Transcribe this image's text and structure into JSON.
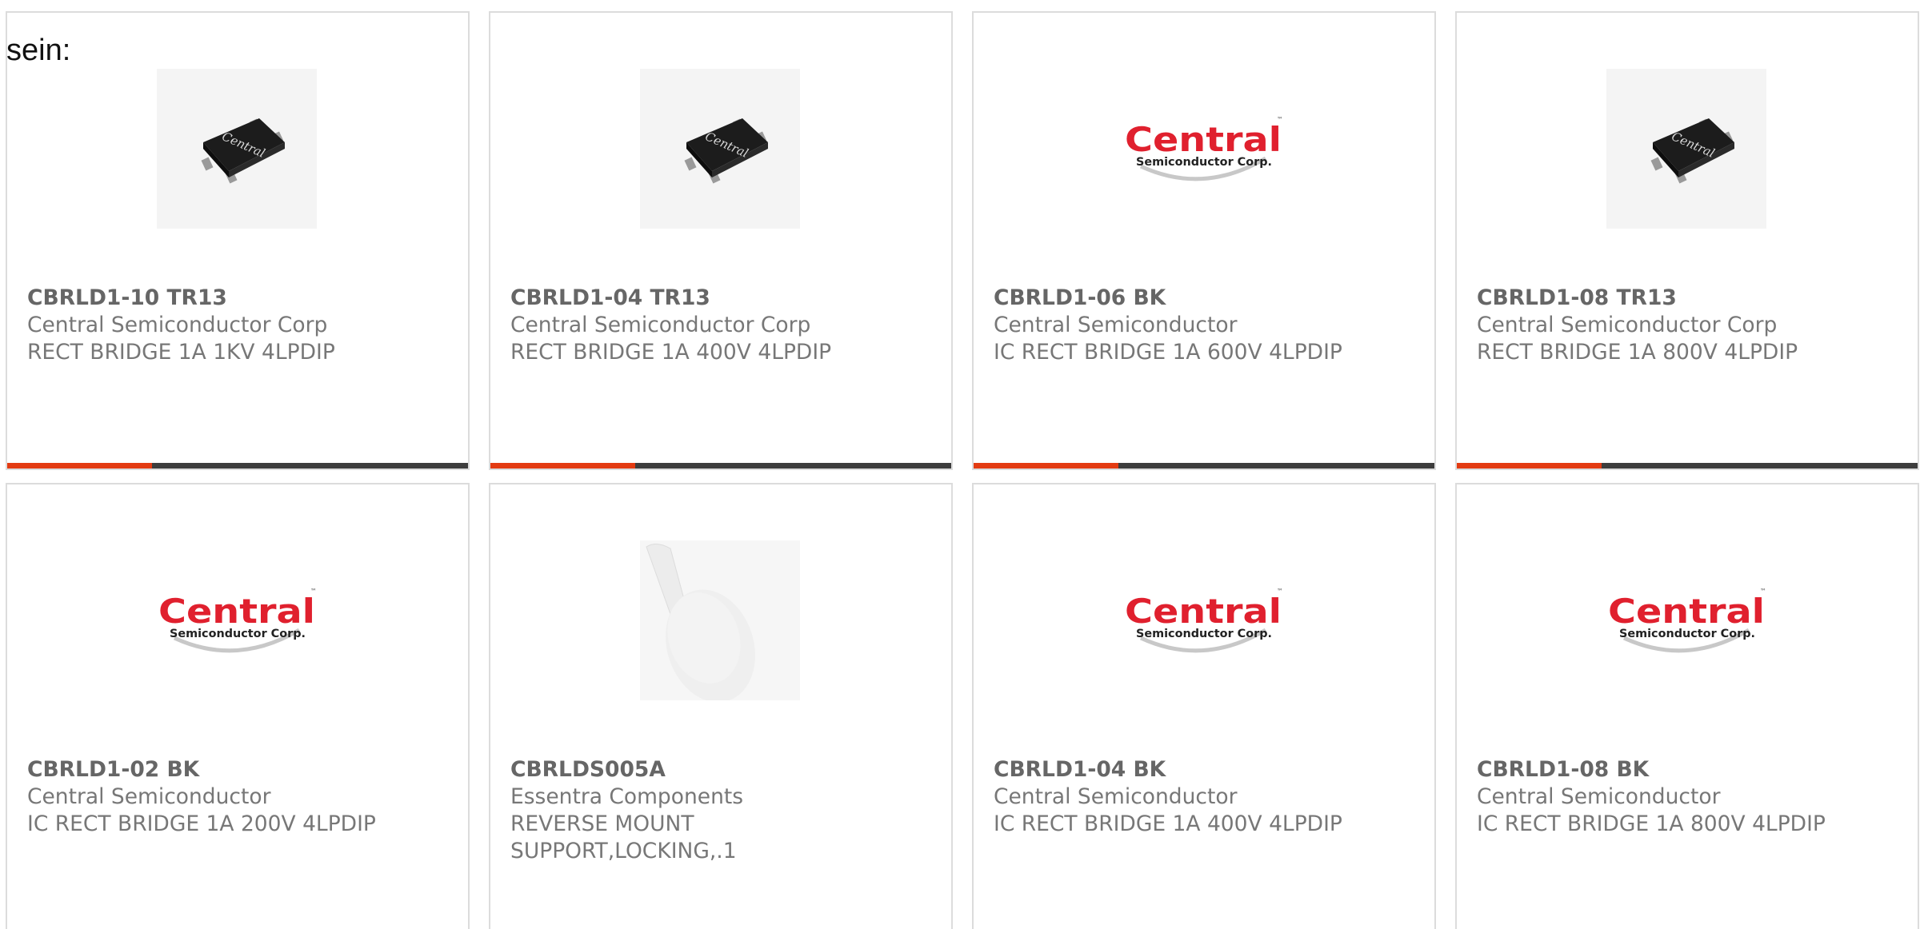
{
  "intro_text": "sein:",
  "accent_color": "#e33b12",
  "bar_color": "#3d3d3d",
  "products": [
    {
      "part_number": "CBRLD1-10 TR13",
      "manufacturer": "Central Semiconductor Corp",
      "description": "RECT BRIDGE 1A 1KV 4LPDIP",
      "image": "bridge-chip-image"
    },
    {
      "part_number": "CBRLD1-04 TR13",
      "manufacturer": "Central Semiconductor Corp",
      "description": "RECT BRIDGE 1A 400V 4LPDIP",
      "image": "bridge-chip-image"
    },
    {
      "part_number": "CBRLD1-06 BK",
      "manufacturer": "Central Semiconductor",
      "description": "IC RECT BRIDGE 1A 600V 4LPDIP",
      "image": "central-logo-image"
    },
    {
      "part_number": "CBRLD1-08 TR13",
      "manufacturer": "Central Semiconductor Corp",
      "description": "RECT BRIDGE 1A 800V 4LPDIP",
      "image": "bridge-chip-image"
    },
    {
      "part_number": "CBRLD1-02 BK",
      "manufacturer": "Central Semiconductor",
      "description": "IC RECT BRIDGE 1A 200V 4LPDIP",
      "image": "central-logo-image"
    },
    {
      "part_number": "CBRLDS005A",
      "manufacturer": "Essentra Components",
      "description": "REVERSE MOUNT SUPPORT,LOCKING,.1",
      "image": "mount-support-image"
    },
    {
      "part_number": "CBRLD1-04 BK",
      "manufacturer": "Central Semiconductor",
      "description": "IC RECT BRIDGE 1A 400V 4LPDIP",
      "image": "central-logo-image"
    },
    {
      "part_number": "CBRLD1-08 BK",
      "manufacturer": "Central Semiconductor",
      "description": "IC RECT BRIDGE 1A 800V 4LPDIP",
      "image": "central-logo-image"
    }
  ],
  "logo": {
    "word": "Central",
    "tagline": "Semiconductor Corp.",
    "tm": "™",
    "chip_marking": "Central"
  }
}
